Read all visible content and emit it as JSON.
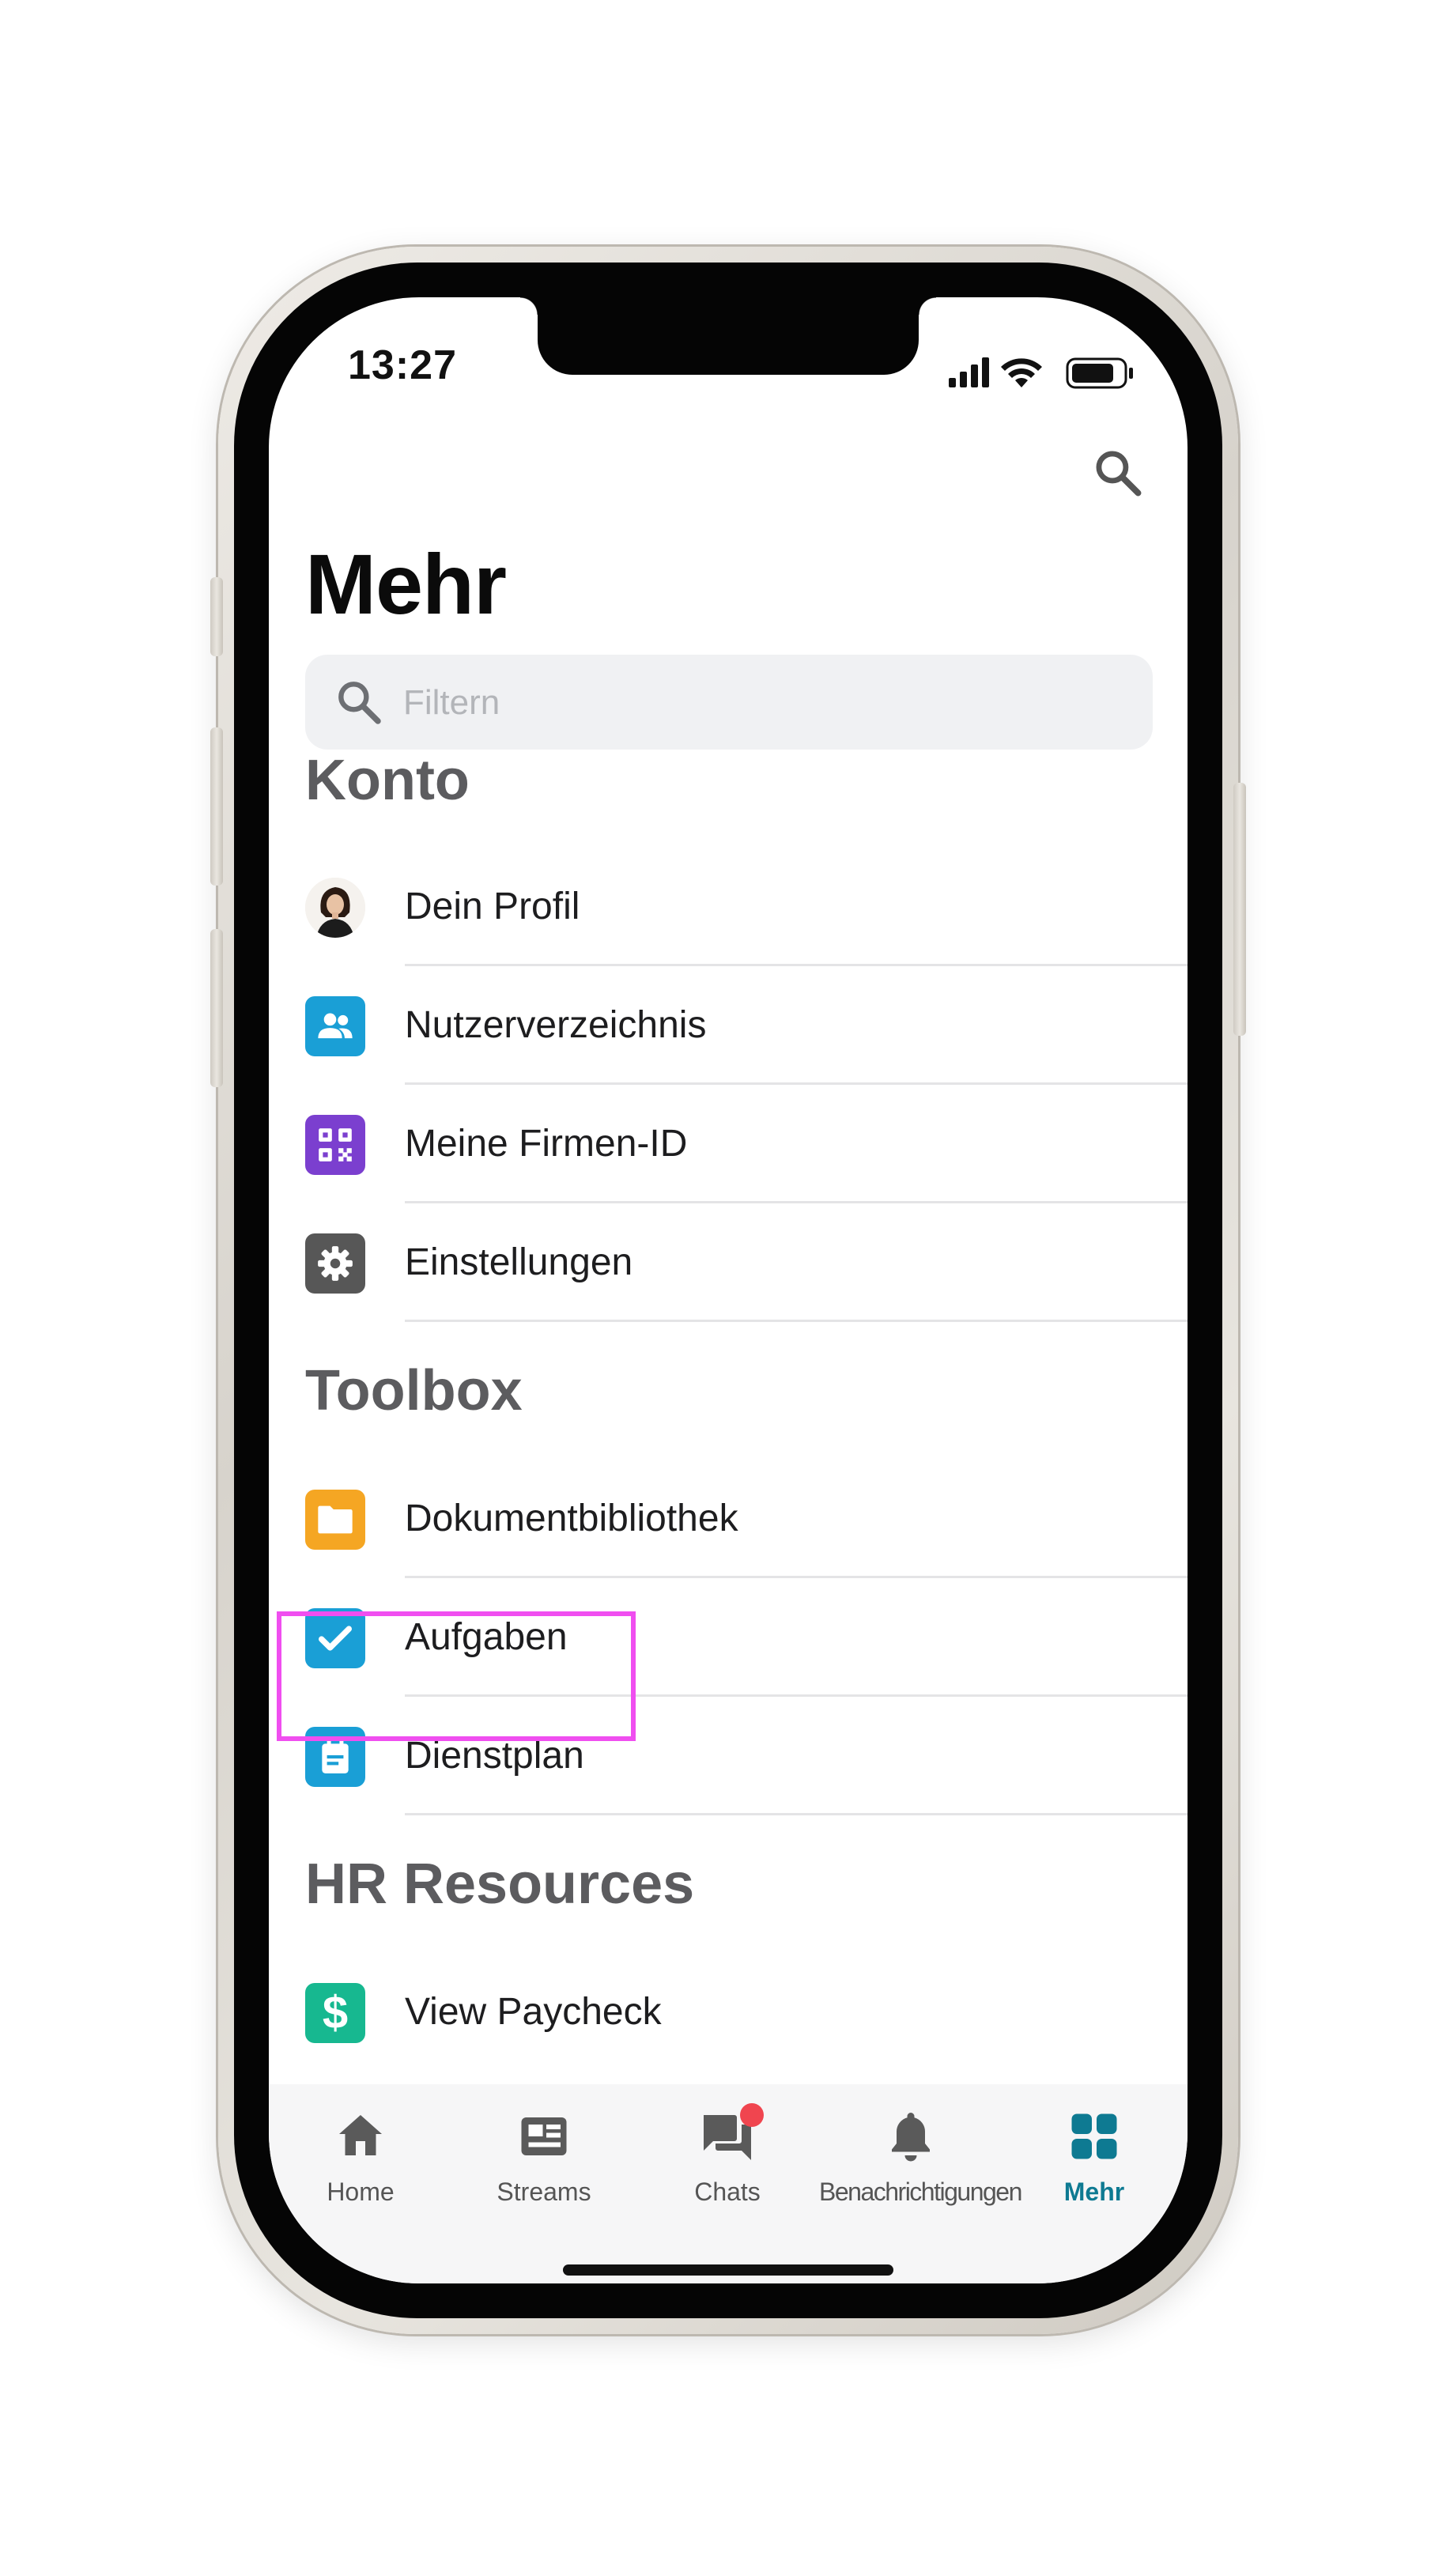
{
  "status_bar": {
    "time": "13:27"
  },
  "page": {
    "title": "Mehr"
  },
  "filter": {
    "placeholder": "Filtern"
  },
  "sections": {
    "konto": {
      "title": "Konto",
      "items": [
        {
          "label": "Dein Profil",
          "icon": "profile-avatar",
          "color": ""
        },
        {
          "label": "Nutzerverzeichnis",
          "icon": "users-icon",
          "color": "#1a9fd6"
        },
        {
          "label": "Meine Firmen-ID",
          "icon": "qr-code-icon",
          "color": "#7b3fcf"
        },
        {
          "label": "Einstellungen",
          "icon": "gear-icon",
          "color": "#575757"
        }
      ]
    },
    "toolbox": {
      "title": "Toolbox",
      "items": [
        {
          "label": "Dokumentbibliothek",
          "icon": "folder-icon",
          "color": "#f5a623"
        },
        {
          "label": "Aufgaben",
          "icon": "checkbox-icon",
          "color": "#1a9fd6"
        },
        {
          "label": "Dienstplan",
          "icon": "calendar-icon",
          "color": "#1a9fd6"
        }
      ]
    },
    "hr": {
      "title": "HR Resources",
      "items": [
        {
          "label": "View Paycheck",
          "icon": "dollar-icon",
          "color": "#17b890"
        }
      ]
    }
  },
  "tabbar": {
    "tabs": [
      {
        "label": "Home",
        "icon": "home-icon"
      },
      {
        "label": "Streams",
        "icon": "streams-icon"
      },
      {
        "label": "Chats",
        "icon": "chat-icon"
      },
      {
        "label": "Benachrichtigungen",
        "icon": "bell-icon"
      },
      {
        "label": "Mehr",
        "icon": "grid-icon"
      }
    ],
    "active": "Mehr",
    "accent": "#0e7a92"
  }
}
